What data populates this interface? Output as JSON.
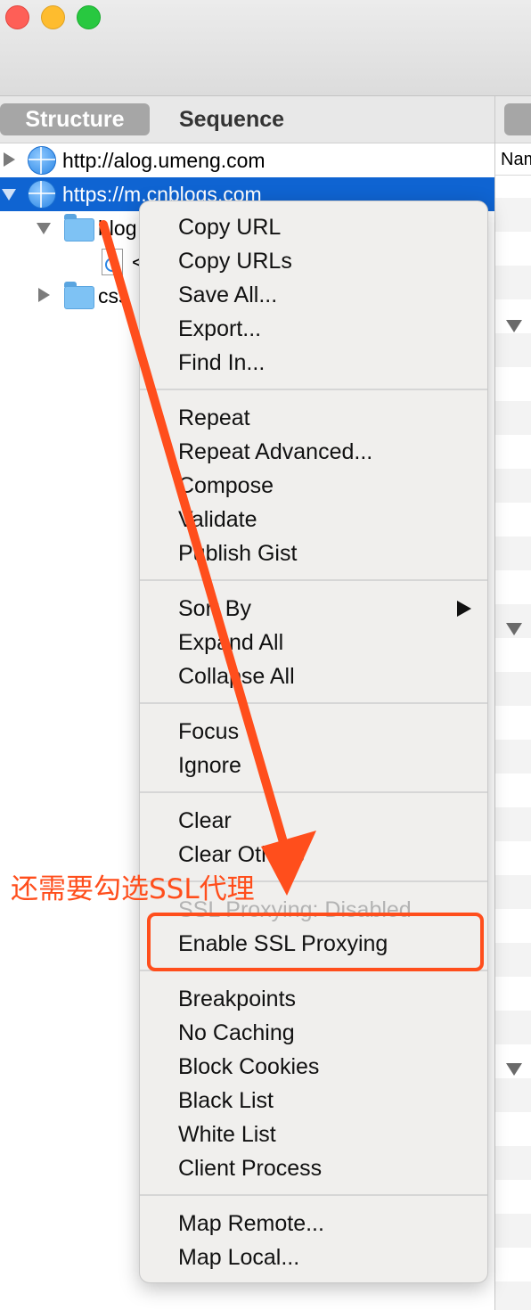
{
  "window": {
    "traffic_lights": [
      "close",
      "minimize",
      "zoom"
    ]
  },
  "tabs": {
    "structure": "Structure",
    "sequence": "Sequence"
  },
  "tree": {
    "host1": "http://alog.umeng.com",
    "host2": "https://m.cnblogs.com",
    "folder_blog": "blog",
    "file_item": "<",
    "folder_css": "css"
  },
  "right_pane": {
    "column_header": "Name"
  },
  "context_menu": {
    "copy_url": "Copy URL",
    "copy_urls": "Copy URLs",
    "save_all": "Save All...",
    "export": "Export...",
    "find_in": "Find In...",
    "repeat": "Repeat",
    "repeat_advanced": "Repeat Advanced...",
    "compose": "Compose",
    "validate": "Validate",
    "publish_gist": "Publish Gist",
    "sort_by": "Sort By",
    "expand_all": "Expand All",
    "collapse_all": "Collapse All",
    "focus": "Focus",
    "ignore": "Ignore",
    "clear": "Clear",
    "clear_others": "Clear Others",
    "ssl_proxying_disabled": "SSL Proxying: Disabled",
    "enable_ssl_proxying": "Enable SSL Proxying",
    "breakpoints": "Breakpoints",
    "no_caching": "No Caching",
    "block_cookies": "Block Cookies",
    "black_list": "Black List",
    "white_list": "White List",
    "client_process": "Client Process",
    "map_remote": "Map Remote...",
    "map_local": "Map Local..."
  },
  "annotation": {
    "text": "还需要勾选SSL代理",
    "color": "#ff4e1c"
  },
  "colors": {
    "selection": "#0f64d2",
    "menu_bg": "#f0efed"
  }
}
